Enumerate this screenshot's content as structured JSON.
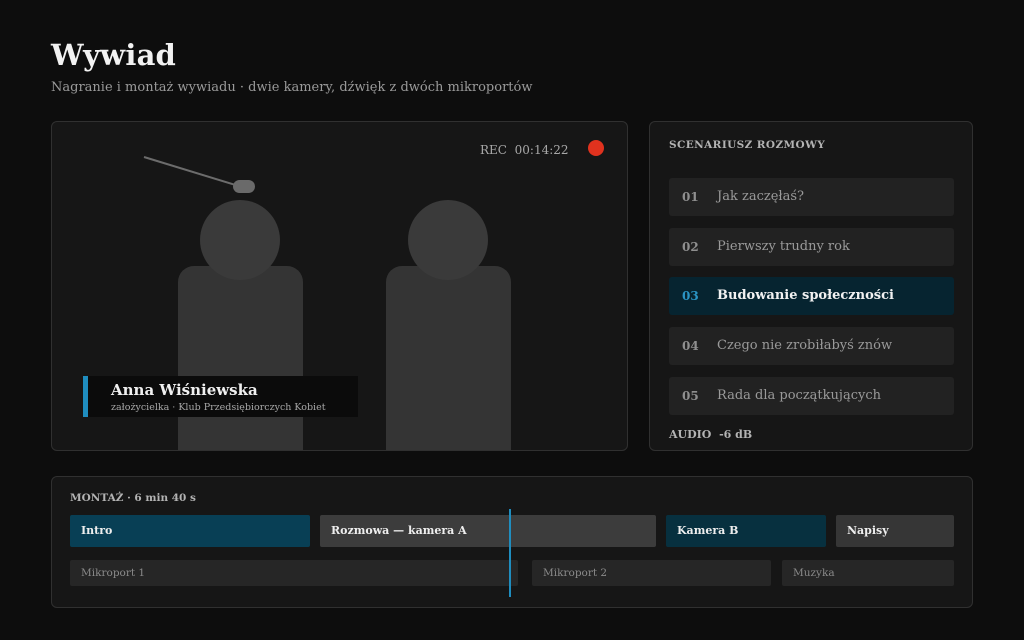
{
  "page": {
    "title": "Wywiad",
    "subtitle": "Nagranie i montaż wywiadu · dwie kamery, dźwięk z dwóch mikroportów"
  },
  "camera": {
    "rec_label": "REC",
    "rec_time": "00:14:22",
    "rec_color": "#e0321e",
    "lower_third": {
      "name": "Anna Wiśniewska",
      "role": "założycielka · Klub Przedsiębiorczych Kobiet",
      "accent_color": "#1f8dbf"
    }
  },
  "script": {
    "heading": "SCENARIUSZ ROZMOWY",
    "items": [
      {
        "num": "01",
        "text": "Jak zaczęłaś?",
        "active": false
      },
      {
        "num": "02",
        "text": "Pierwszy trudny rok",
        "active": false
      },
      {
        "num": "03",
        "text": "Budowanie społeczności",
        "active": true
      },
      {
        "num": "04",
        "text": "Czego nie zrobiłabyś znów",
        "active": false
      },
      {
        "num": "05",
        "text": "Rada dla początkujących",
        "active": false
      }
    ],
    "audio_label": "AUDIO",
    "audio_level": "-6 dB"
  },
  "timeline": {
    "heading": "MONTAŻ · 6 min 40 s",
    "clips": [
      {
        "label": "Intro",
        "color": "#083f55"
      },
      {
        "label": "Rozmowa — kamera A",
        "color": "#3c3c3c"
      },
      {
        "label": "Kamera B",
        "color": "#07303f"
      },
      {
        "label": "Napisy",
        "color": "#363636"
      }
    ],
    "audio_tracks": [
      {
        "label": "Mikroport 1"
      },
      {
        "label": "Mikroport 2"
      },
      {
        "label": "Muzyka"
      }
    ],
    "playhead_color": "#1f8dbf"
  }
}
